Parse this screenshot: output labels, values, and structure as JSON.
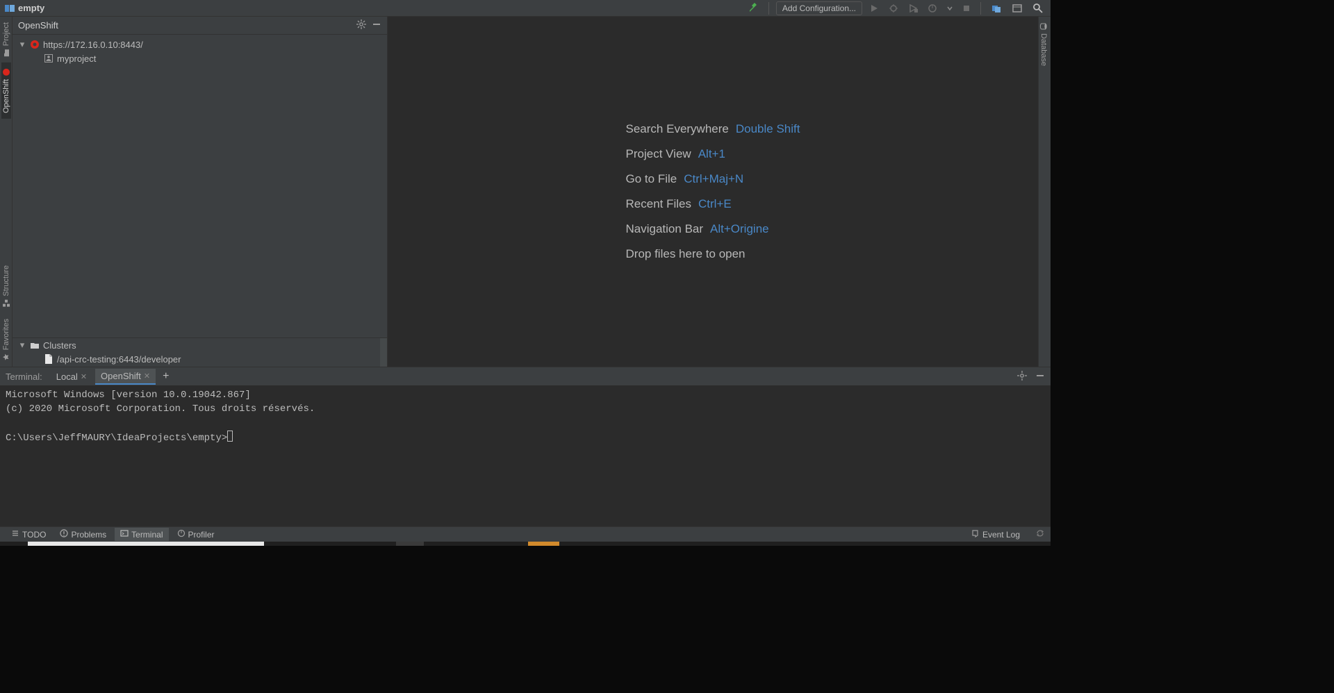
{
  "titlebar": {
    "project_name": "empty",
    "add_configuration": "Add Configuration..."
  },
  "left_rail": {
    "project": "Project",
    "openshift": "OpenShift",
    "structure": "Structure",
    "favorites": "Favorites"
  },
  "right_rail": {
    "database": "Database"
  },
  "openshift_pane": {
    "title": "OpenShift",
    "server_url": "https://172.16.0.10:8443/",
    "project_node": "myproject",
    "clusters_label": "Clusters",
    "cluster_entry": "/api-crc-testing:6443/developer"
  },
  "editor_hints": {
    "search_label": "Search Everywhere",
    "search_key": "Double Shift",
    "project_view_label": "Project View",
    "project_view_key": "Alt+1",
    "goto_file_label": "Go to File",
    "goto_file_key": "Ctrl+Maj+N",
    "recent_files_label": "Recent Files",
    "recent_files_key": "Ctrl+E",
    "navbar_label": "Navigation Bar",
    "navbar_key": "Alt+Origine",
    "drop_hint": "Drop files here to open"
  },
  "terminal": {
    "title": "Terminal:",
    "tabs": {
      "local": "Local",
      "openshift": "OpenShift"
    },
    "line1": "Microsoft Windows [version 10.0.19042.867]",
    "line2": "(c) 2020 Microsoft Corporation. Tous droits réservés.",
    "prompt": "C:\\Users\\JeffMAURY\\IdeaProjects\\empty>"
  },
  "bottom": {
    "todo": "TODO",
    "problems": "Problems",
    "terminal": "Terminal",
    "profiler": "Profiler",
    "event_log": "Event Log"
  }
}
